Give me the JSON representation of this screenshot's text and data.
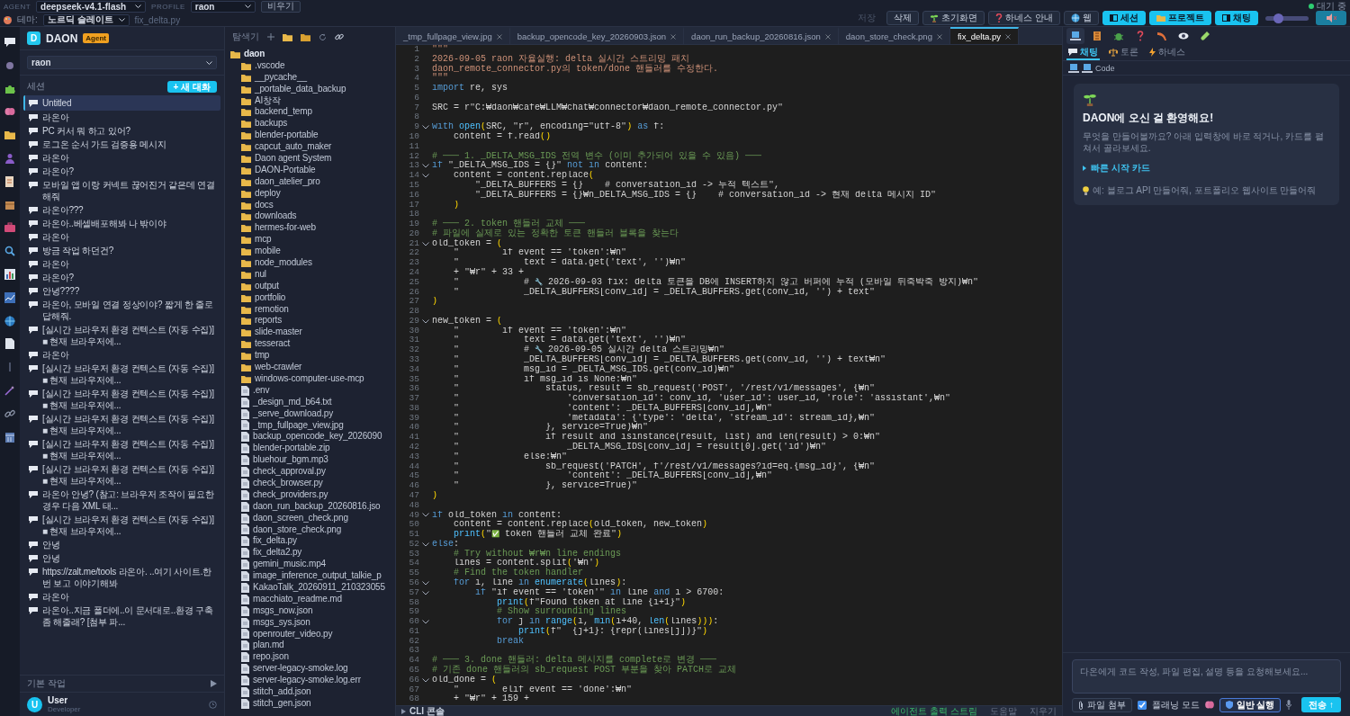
{
  "top_bar": {
    "agent_label": "AGENT",
    "agent_model": "deepseek-v4.1-flash",
    "profile_label": "PROFILE",
    "profile": "raon",
    "clear_button": "비우기",
    "theme_label": "테마:",
    "theme": "노르딕 슬레이트",
    "open_file": "fix_delta.py",
    "buttons": [
      {
        "label": "저장",
        "disabled": true,
        "kind": "plain"
      },
      {
        "label": "삭제",
        "disabled": false,
        "kind": "plain"
      },
      {
        "label": "초기화면",
        "disabled": false,
        "kind": "plain"
      },
      {
        "label": "하네스 안내",
        "disabled": false,
        "kind": "plain"
      },
      {
        "label": "웹",
        "disabled": false,
        "kind": "plain"
      },
      {
        "label": "세션",
        "disabled": false,
        "kind": "accent"
      },
      {
        "label": "프로젝트",
        "disabled": false,
        "kind": "accent"
      },
      {
        "label": "채팅",
        "disabled": false,
        "kind": "accent"
      }
    ],
    "zoom_slider": {
      "level": 0.3
    },
    "status": "대기 중"
  },
  "sidebar": {
    "logo": "D",
    "title": "DAON",
    "badge": "Agent",
    "profile": "raon",
    "sessions_label": "세션",
    "new_chat_button": "+ 새 대화",
    "sessions": [
      {
        "title": "Untitled",
        "selected": true
      },
      {
        "title": "라온아",
        "selected": false
      },
      {
        "title": "PC 커서 뭐 하고 있어?",
        "selected": false
      },
      {
        "title": "로그온 순서 가드 검증용 메시지",
        "selected": false
      },
      {
        "title": "라온아",
        "selected": false
      },
      {
        "title": "라온아?",
        "selected": false
      },
      {
        "title": "모바일 앱 이랑 커넥트 끊어진거 같은데 연결 해줘",
        "selected": false
      },
      {
        "title": "라온아???",
        "selected": false
      },
      {
        "title": "라온아..베셀배포해봐 나 밖이야",
        "selected": false
      },
      {
        "title": "라온아",
        "selected": false
      },
      {
        "title": "방금 작업 하던건?",
        "selected": false
      },
      {
        "title": "라온아",
        "selected": false
      },
      {
        "title": "라온아?",
        "selected": false
      },
      {
        "title": "안녕????",
        "selected": false
      },
      {
        "title": "라온아, 모바일 연결 정상이야? 짧게 한 줄로 답해줘.",
        "selected": false
      },
      {
        "title": "[실시간 브라우저 환경 컨텍스트 (자동 수집)] ■ 현재 브라우저에...",
        "selected": false
      },
      {
        "title": "라온아",
        "selected": false
      },
      {
        "title": "[실시간 브라우저 환경 컨텍스트 (자동 수집)] ■ 현재 브라우저에...",
        "selected": false
      },
      {
        "title": "[실시간 브라우저 환경 컨텍스트 (자동 수집)] ■ 현재 브라우저에...",
        "selected": false
      },
      {
        "title": "[실시간 브라우저 환경 컨텍스트 (자동 수집)] ■ 현재 브라우저에...",
        "selected": false
      },
      {
        "title": "[실시간 브라우저 환경 컨텍스트 (자동 수집)] ■ 현재 브라우저에...",
        "selected": false
      },
      {
        "title": "[실시간 브라우저 환경 컨텍스트 (자동 수집)] ■ 현재 브라우저에...",
        "selected": false
      },
      {
        "title": "라온아 안녕? (참고: 브라우저 조작이 필요한 경우 다음 XML 태...",
        "selected": false
      },
      {
        "title": "[실시간 브라우저 환경 컨텍스트 (자동 수집)] ■ 현재 브라우저에...",
        "selected": false
      },
      {
        "title": "안녕",
        "selected": false
      },
      {
        "title": "안녕",
        "selected": false
      },
      {
        "title": "https://zalt.me/tools 라온아. ..여기 사이트.한번 보고 이야기해봐",
        "selected": false
      },
      {
        "title": "라온아",
        "selected": false
      },
      {
        "title": "라온아..지금 폴더에..이 문서대로..환경 구축 좀 해줄래? [첨부 파...",
        "selected": false
      }
    ],
    "footer_label": "기본 작업",
    "user": {
      "avatar": "U",
      "name": "User",
      "role": "Developer"
    }
  },
  "explorer": {
    "title": "탐색기",
    "root": {
      "name": "daon",
      "kind": "folder",
      "children": [
        {
          "name": ".vscode",
          "kind": "folder"
        },
        {
          "name": "__pycache__",
          "kind": "folder"
        },
        {
          "name": "_portable_data_backup",
          "kind": "folder"
        },
        {
          "name": "AI창작",
          "kind": "folder"
        },
        {
          "name": "backend_temp",
          "kind": "folder"
        },
        {
          "name": "backups",
          "kind": "folder"
        },
        {
          "name": "blender-portable",
          "kind": "folder"
        },
        {
          "name": "capcut_auto_maker",
          "kind": "folder"
        },
        {
          "name": "Daon agent System",
          "kind": "folder"
        },
        {
          "name": "DAON-Portable",
          "kind": "folder"
        },
        {
          "name": "daon_atelier_pro",
          "kind": "folder"
        },
        {
          "name": "deploy",
          "kind": "folder"
        },
        {
          "name": "docs",
          "kind": "folder"
        },
        {
          "name": "downloads",
          "kind": "folder"
        },
        {
          "name": "hermes-for-web",
          "kind": "folder"
        },
        {
          "name": "mcp",
          "kind": "folder"
        },
        {
          "name": "mobile",
          "kind": "folder"
        },
        {
          "name": "node_modules",
          "kind": "folder"
        },
        {
          "name": "nul",
          "kind": "folder"
        },
        {
          "name": "output",
          "kind": "folder"
        },
        {
          "name": "portfolio",
          "kind": "folder"
        },
        {
          "name": "remotion",
          "kind": "folder"
        },
        {
          "name": "reports",
          "kind": "folder"
        },
        {
          "name": "slide-master",
          "kind": "folder"
        },
        {
          "name": "tesseract",
          "kind": "folder"
        },
        {
          "name": "tmp",
          "kind": "folder"
        },
        {
          "name": "web-crawler",
          "kind": "folder"
        },
        {
          "name": "windows-computer-use-mcp",
          "kind": "folder"
        },
        {
          "name": ".env",
          "kind": "file"
        },
        {
          "name": "_design_md_b64.txt",
          "kind": "file"
        },
        {
          "name": "_serve_download.py",
          "kind": "file"
        },
        {
          "name": "_tmp_fullpage_view.jpg",
          "kind": "file"
        },
        {
          "name": "backup_opencode_key_2026090",
          "kind": "file"
        },
        {
          "name": "blender-portable.zip",
          "kind": "file"
        },
        {
          "name": "bluehour_bgm.mp3",
          "kind": "file"
        },
        {
          "name": "check_approval.py",
          "kind": "file"
        },
        {
          "name": "check_browser.py",
          "kind": "file"
        },
        {
          "name": "check_providers.py",
          "kind": "file"
        },
        {
          "name": "daon_run_backup_20260816.jso",
          "kind": "file"
        },
        {
          "name": "daon_screen_check.png",
          "kind": "file"
        },
        {
          "name": "daon_store_check.png",
          "kind": "file"
        },
        {
          "name": "fix_delta.py",
          "kind": "file"
        },
        {
          "name": "fix_delta2.py",
          "kind": "file"
        },
        {
          "name": "gemini_music.mp4",
          "kind": "file"
        },
        {
          "name": "image_inference_output_talkie_p",
          "kind": "file"
        },
        {
          "name": "KakaoTalk_20260911_210323055",
          "kind": "file"
        },
        {
          "name": "macchiato_readme.md",
          "kind": "file"
        },
        {
          "name": "msgs_now.json",
          "kind": "file"
        },
        {
          "name": "msgs_sys.json",
          "kind": "file"
        },
        {
          "name": "openrouter_video.py",
          "kind": "file"
        },
        {
          "name": "plan.md",
          "kind": "file"
        },
        {
          "name": "repo.json",
          "kind": "file"
        },
        {
          "name": "server-legacy-smoke.log",
          "kind": "file"
        },
        {
          "name": "server-legacy-smoke.log.err",
          "kind": "file"
        },
        {
          "name": "stitch_add.json",
          "kind": "file"
        },
        {
          "name": "stitch_gen.json",
          "kind": "file"
        }
      ]
    }
  },
  "editor": {
    "tabs": [
      {
        "label": "_tmp_fullpage_view.jpg",
        "selected": false
      },
      {
        "label": "backup_opencode_key_20260903.json",
        "selected": false
      },
      {
        "label": "daon_run_backup_20260816.json",
        "selected": false
      },
      {
        "label": "daon_store_check.png",
        "selected": false
      },
      {
        "label": "fix_delta.py",
        "selected": true
      }
    ],
    "lines": [
      {
        "n": "1",
        "kind": "doc",
        "text": "\"\"\"",
        "fold": false
      },
      {
        "n": "2",
        "kind": "doc",
        "text": "2026-09-05 raon 자율실행: delta 실시간 스트리밍 패치",
        "fold": false
      },
      {
        "n": "3",
        "kind": "doc",
        "text": "daon_remote_connector.py의 token/done 핸들러를 수정한다.",
        "fold": false
      },
      {
        "n": "4",
        "kind": "doc",
        "text": "\"\"\"",
        "fold": false
      },
      {
        "n": "5",
        "kind": "code",
        "text": "import re, sys",
        "fold": false
      },
      {
        "n": "6",
        "kind": "blank",
        "fold": false
      },
      {
        "n": "7",
        "kind": "code",
        "text": "SRC = r\"C:₩daon₩cafe₩LLM₩chat₩connector₩daon_remote_connector.py\"",
        "fold": false
      },
      {
        "n": "8",
        "kind": "blank",
        "fold": false
      },
      {
        "n": "9",
        "kind": "code",
        "text": "with open(SRC, \"r\", encoding=\"utf-8\") as f:",
        "fold": true
      },
      {
        "n": "10",
        "kind": "code",
        "text": "    content = f.read()",
        "fold": false
      },
      {
        "n": "11",
        "kind": "blank",
        "fold": false
      },
      {
        "n": "12",
        "kind": "comment",
        "text": "# ─── 1. _DELTA_MSG_IDS 전역 변수 (이미 추가되어 있을 수 있음) ───",
        "fold": false
      },
      {
        "n": "13",
        "kind": "code",
        "text": "if \"_DELTA_MSG_IDS = {}\" not in content:",
        "fold": true
      },
      {
        "n": "14",
        "kind": "code",
        "text": "    content = content.replace(",
        "fold": true
      },
      {
        "n": "15",
        "kind": "code",
        "text": "        \"_DELTA_BUFFERS = {}    # conversation_id -> 누적 텍스트\",",
        "fold": false
      },
      {
        "n": "16",
        "kind": "code",
        "text": "        \"_DELTA_BUFFERS = {}₩n_DELTA_MSG_IDS = {}    # conversation_id -> 현재 delta 메시지 ID\"",
        "fold": false
      },
      {
        "n": "17",
        "kind": "code",
        "text": "    )",
        "fold": false
      },
      {
        "n": "18",
        "kind": "blank",
        "fold": false
      },
      {
        "n": "19",
        "kind": "comment",
        "text": "# ─── 2. token 핸들러 교체 ───",
        "fold": false
      },
      {
        "n": "20",
        "kind": "comment",
        "text": "# 파일에 실제로 있는 정확한 토큰 핸들러 블록을 찾는다",
        "fold": false
      },
      {
        "n": "21",
        "kind": "code",
        "text": "old_token = (",
        "fold": true
      },
      {
        "n": "22",
        "kind": "code",
        "text": "    \"        if event == 'token':₩n\"",
        "fold": false
      },
      {
        "n": "23",
        "kind": "code",
        "text": "    \"            text = data.get('text', '')₩n\"",
        "fold": false
      },
      {
        "n": "24",
        "kind": "code",
        "text": "    + \"₩r\" + 33 +",
        "fold": false
      },
      {
        "n": "25",
        "kind": "code",
        "text": "    \"            # 🔧 2026-09-03 fix: delta 토큰을 DB에 INSERT하지 않고 버퍼에 누적 (모바일 뒤죽박죽 방지)₩n\"",
        "fold": false
      },
      {
        "n": "26",
        "kind": "code",
        "text": "    \"            _DELTA_BUFFERS[conv_id] = _DELTA_BUFFERS.get(conv_id, '') + text\"",
        "fold": false
      },
      {
        "n": "27",
        "kind": "code",
        "text": ")",
        "fold": false
      },
      {
        "n": "28",
        "kind": "blank",
        "fold": false
      },
      {
        "n": "29",
        "kind": "code",
        "text": "new_token = (",
        "fold": true
      },
      {
        "n": "30",
        "kind": "code",
        "text": "    \"        if event == 'token':₩n\"",
        "fold": false
      },
      {
        "n": "31",
        "kind": "code",
        "text": "    \"            text = data.get('text', '')₩n\"",
        "fold": false
      },
      {
        "n": "32",
        "kind": "code",
        "text": "    \"            # 🔧 2026-09-05 실시간 delta 스트리밍₩n\"",
        "fold": false
      },
      {
        "n": "33",
        "kind": "code",
        "text": "    \"            _DELTA_BUFFERS[conv_id] = _DELTA_BUFFERS.get(conv_id, '') + text₩n\"",
        "fold": false
      },
      {
        "n": "34",
        "kind": "code",
        "text": "    \"            msg_id = _DELTA_MSG_IDS.get(conv_id)₩n\"",
        "fold": false
      },
      {
        "n": "35",
        "kind": "code",
        "text": "    \"            if msg_id is None:₩n\"",
        "fold": false
      },
      {
        "n": "36",
        "kind": "code",
        "text": "    \"                status, result = sb_request('POST', '/rest/v1/messages', {₩n\"",
        "fold": false
      },
      {
        "n": "37",
        "kind": "code",
        "text": "    \"                    'conversation_id': conv_id, 'user_id': user_id, 'role': 'assistant',₩n\"",
        "fold": false
      },
      {
        "n": "38",
        "kind": "code",
        "text": "    \"                    'content': _DELTA_BUFFERS[conv_id],₩n\"",
        "fold": false
      },
      {
        "n": "39",
        "kind": "code",
        "text": "    \"                    'metadata': {'type': 'delta', 'stream_id': stream_id},₩n\"",
        "fold": false
      },
      {
        "n": "40",
        "kind": "code",
        "text": "    \"                }, service=True)₩n\"",
        "fold": false
      },
      {
        "n": "41",
        "kind": "code",
        "text": "    \"                if result and isinstance(result, list) and len(result) > 0:₩n\"",
        "fold": false
      },
      {
        "n": "42",
        "kind": "code",
        "text": "    \"                    _DELTA_MSG_IDS[conv_id] = result[0].get('id')₩n\"",
        "fold": false
      },
      {
        "n": "43",
        "kind": "code",
        "text": "    \"            else:₩n\"",
        "fold": false
      },
      {
        "n": "44",
        "kind": "code",
        "text": "    \"                sb_request('PATCH', f'/rest/v1/messages?id=eq.{msg_id}', {₩n\"",
        "fold": false
      },
      {
        "n": "45",
        "kind": "code",
        "text": "    \"                    'content': _DELTA_BUFFERS[conv_id],₩n\"",
        "fold": false
      },
      {
        "n": "46",
        "kind": "code",
        "text": "    \"                }, service=True)\"",
        "fold": false
      },
      {
        "n": "47",
        "kind": "code",
        "text": ")",
        "fold": false
      },
      {
        "n": "48",
        "kind": "blank",
        "fold": false
      },
      {
        "n": "49",
        "kind": "code",
        "text": "if old_token in content:",
        "fold": true
      },
      {
        "n": "50",
        "kind": "code",
        "text": "    content = content.replace(old_token, new_token)",
        "fold": false
      },
      {
        "n": "51",
        "kind": "code",
        "text": "    print(\"✅ token 핸들러 교체 완료\")",
        "fold": false
      },
      {
        "n": "52",
        "kind": "code",
        "text": "else:",
        "fold": true
      },
      {
        "n": "53",
        "kind": "comment",
        "text": "    # Try without ₩r₩n line endings",
        "fold": false
      },
      {
        "n": "54",
        "kind": "code",
        "text": "    lines = content.split('₩n')",
        "fold": false
      },
      {
        "n": "55",
        "kind": "comment",
        "text": "    # Find the token handler",
        "fold": false
      },
      {
        "n": "56",
        "kind": "code",
        "text": "    for i, line in enumerate(lines):",
        "fold": true
      },
      {
        "n": "57",
        "kind": "code",
        "text": "        if \"if event == 'token'\" in line and i > 6700:",
        "fold": true
      },
      {
        "n": "58",
        "kind": "code",
        "text": "            print(f\"Found token at line {i+1}\")",
        "fold": false
      },
      {
        "n": "59",
        "kind": "comment",
        "text": "            # Show surrounding lines",
        "fold": false
      },
      {
        "n": "60",
        "kind": "code",
        "text": "            for j in range(i, min(i+40, len(lines))):",
        "fold": true
      },
      {
        "n": "61",
        "kind": "code",
        "text": "                print(f\"  {j+1}: {repr(lines[j])}\")",
        "fold": false
      },
      {
        "n": "62",
        "kind": "code",
        "text": "            break",
        "fold": false
      },
      {
        "n": "63",
        "kind": "blank",
        "fold": false
      },
      {
        "n": "64",
        "kind": "comment",
        "text": "# ─── 3. done 핸들러: delta 메시지를 complete로 변경 ───",
        "fold": false
      },
      {
        "n": "65",
        "kind": "comment",
        "text": "# 기존 done 핸들러의 sb_request POST 부분을 찾아 PATCH로 교체",
        "fold": false
      },
      {
        "n": "66",
        "kind": "code",
        "text": "old_done = (",
        "fold": true
      },
      {
        "n": "67",
        "kind": "code",
        "text": "    \"        elif event == 'done':₩n\"",
        "fold": false
      },
      {
        "n": "68",
        "kind": "code",
        "text": "    + \"₩r\" + 159 +",
        "fold": false
      }
    ],
    "console": {
      "label": "CLI 콘솔",
      "stream": "에이전트 출력 스트림",
      "help": "도움말",
      "clear": "지우기"
    }
  },
  "assistant": {
    "tool_tabs": [
      {
        "selected": true
      },
      {
        "selected": false
      },
      {
        "selected": false
      },
      {
        "selected": false
      },
      {
        "selected": false
      },
      {
        "selected": false
      },
      {
        "selected": false
      }
    ],
    "sub_tabs": [
      {
        "label": "채팅",
        "selected": true
      },
      {
        "label": "토론",
        "selected": false
      },
      {
        "label": "하네스",
        "selected": false
      }
    ],
    "mode": "Code",
    "welcome": {
      "title": "DAON에 오신 걸 환영해요!",
      "text": "무엇을 만들어볼까요? 아래 입력창에 바로 적거나, 카드를 펼쳐서 골라보세요.",
      "quick_start": "빠른 시작 카드",
      "example": "예: 블로그 API 만들어줘, 포트폴리오 웹사이트 만들어줘"
    },
    "input": {
      "placeholder": "다온에게 코드 작성, 파일 편집, 설명 등을 요청해보세요..."
    },
    "attach_button": "파일 첨부",
    "planning_mode": {
      "label": "플래닝 모드",
      "checked": true
    },
    "run_mode_button": "일반 실행",
    "send_button": "전송 ↑"
  }
}
